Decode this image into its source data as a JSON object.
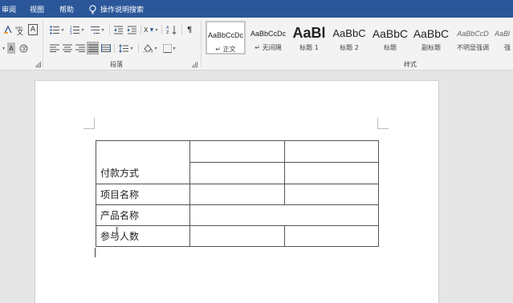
{
  "menu": {
    "items": [
      "审阅",
      "视图",
      "帮助"
    ],
    "tell_me": "操作说明搜索"
  },
  "ribbon": {
    "paragraph_group_label": "段落",
    "styles_group_label": "样式",
    "styles": [
      {
        "sample": "AaBbCcDc",
        "name": "↵ 正文",
        "selected": true
      },
      {
        "sample": "AaBbCcDc",
        "name": "↵ 无间隔",
        "selected": false
      },
      {
        "sample": "AaBl",
        "name": "标题 1",
        "selected": false
      },
      {
        "sample": "AaBbC",
        "name": "标题 2",
        "selected": false
      },
      {
        "sample": "AaBbC",
        "name": "标题",
        "selected": false
      },
      {
        "sample": "AaBbC",
        "name": "副标题",
        "selected": false
      },
      {
        "sample": "AaBbCcD",
        "name": "不明显强调",
        "selected": false
      },
      {
        "sample": "AaBl",
        "name": "强",
        "selected": false
      }
    ]
  },
  "document": {
    "table_rows": [
      {
        "label": "付款方式"
      },
      {
        "label": "项目名称"
      },
      {
        "label": "产品名称"
      },
      {
        "label": "参与人数"
      }
    ],
    "cursor_glyph": "I"
  }
}
